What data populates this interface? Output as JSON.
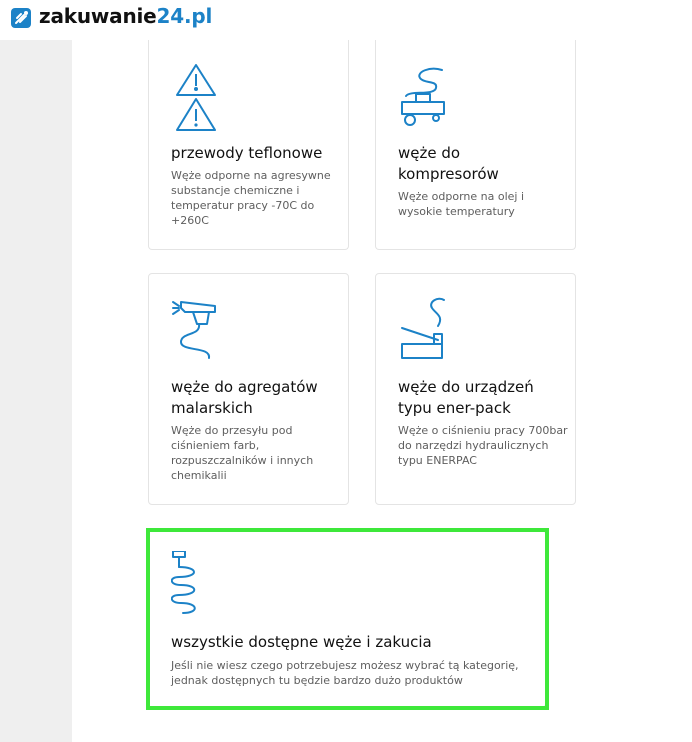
{
  "header": {
    "logo_text": "zakuwanie",
    "logo_accent": "24.pl",
    "brand_color": "#1c82c7"
  },
  "categories": [
    {
      "title": "przewody teflonowe",
      "description": "Węże odporne na agresywne substancje chemiczne i temperatur pracy -70C do +260C",
      "icon": "warning-triangles-icon"
    },
    {
      "title": "węże do kompresorów",
      "description": "Węże odporne na olej i wysokie temperatury",
      "icon": "compressor-icon"
    },
    {
      "title": "węże do agregatów malarskich",
      "description": "Węże do przesyłu pod ciśnieniem farb, rozpuszczalników i innych chemikalii",
      "icon": "spray-gun-icon"
    },
    {
      "title": "węże do urządzeń typu ener-pack",
      "description": "Węże o ciśnieniu pracy 700bar do narzędzi hydraulicznych typu ENERPAC",
      "icon": "hydraulic-press-icon"
    },
    {
      "title": "wszystkie dostępne węże i zakucia",
      "description": "Jeśli nie wiesz czego potrzebujesz możesz wybrać tą kategorię, jednak dostępnych tu będzie bardzo dużo produktów",
      "icon": "coiled-hose-icon"
    }
  ],
  "highlight_color": "#3ee83a"
}
